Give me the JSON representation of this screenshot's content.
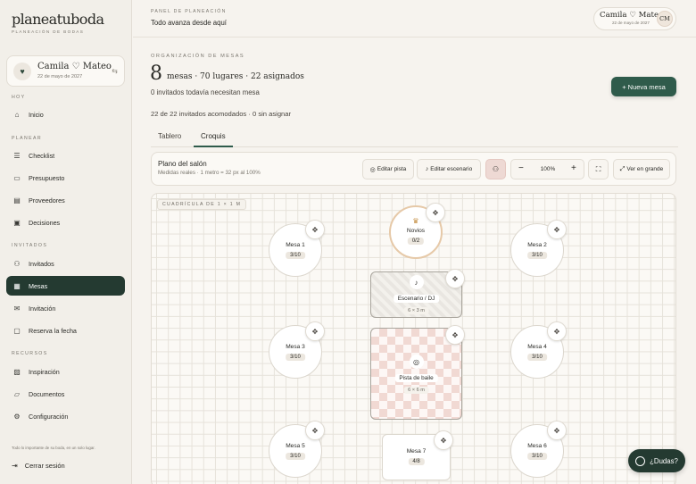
{
  "sidebar": {
    "brand": "planeatuboda",
    "brand_sub": "PLANEACIÓN DE BODAS",
    "couple": {
      "names": "Camila ♡ Mateo",
      "date": "22 de mayo de 2027",
      "heart_icon": "heart-icon",
      "switch_icon": "switch-icon"
    },
    "sections": {
      "hoy": "HOY",
      "planear": "PLANEAR",
      "invitados": "INVITADOS",
      "recursos": "RECURSOS"
    },
    "items": [
      {
        "label": "Inicio",
        "icon": "home-icon"
      },
      {
        "label": "Checklist",
        "icon": "checklist-icon"
      },
      {
        "label": "Presupuesto",
        "icon": "wallet-icon"
      },
      {
        "label": "Proveedores",
        "icon": "store-icon"
      },
      {
        "label": "Decisiones",
        "icon": "decision-icon"
      },
      {
        "label": "Invitados",
        "icon": "users-icon"
      },
      {
        "label": "Mesas",
        "icon": "table-icon"
      },
      {
        "label": "Invitación",
        "icon": "mail-icon"
      },
      {
        "label": "Reserva la fecha",
        "icon": "calendar-icon"
      },
      {
        "label": "Inspiración",
        "icon": "image-icon"
      },
      {
        "label": "Documentos",
        "icon": "folder-icon"
      },
      {
        "label": "Configuración",
        "icon": "gear-icon"
      }
    ],
    "footer": "Todo lo importante de su boda, en un solo lugar.",
    "logout": "Cerrar sesión"
  },
  "topbar": {
    "label": "PANEL DE PLANEACIÓN",
    "title": "Todo avanza desde aquí",
    "user": {
      "names": "Camila ♡ Mateo",
      "date": "22 de mayo de 2027",
      "initials": "CM"
    }
  },
  "main": {
    "label": "ORGANIZACIÓN DE MESAS",
    "count": "8",
    "stats": "mesas · 70 lugares · 22 asignados",
    "pending": "0 invitados todavía necesitan mesa",
    "new_button": "+ Nueva mesa",
    "seated": "22 de 22 invitados acomodados · 0 sin asignar",
    "tabs": [
      {
        "label": "Tablero"
      },
      {
        "label": "Croquis"
      }
    ]
  },
  "toolbar": {
    "title": "Plano del salón",
    "subtitle": "Medidas reales · 1 metro = 32 px al 100%",
    "edit_room": "Editar pista",
    "edit_stage": "Editar escenario",
    "zoom": "100%",
    "fullscreen": "Ver en grande"
  },
  "canvas": {
    "grid_label": "CUADRÍCULA DE 1 × 1 M",
    "tables": [
      {
        "name": "Novios",
        "occ": "0/2"
      },
      {
        "name": "Mesa 1",
        "occ": "3/10"
      },
      {
        "name": "Mesa 2",
        "occ": "3/10"
      },
      {
        "name": "Mesa 3",
        "occ": "3/10"
      },
      {
        "name": "Mesa 4",
        "occ": "3/10"
      },
      {
        "name": "Mesa 5",
        "occ": "3/10"
      },
      {
        "name": "Mesa 6",
        "occ": "3/10"
      },
      {
        "name": "Mesa 7",
        "occ": "4/8"
      }
    ],
    "stage": {
      "name": "Escenario / DJ",
      "size": "6 × 3 m"
    },
    "dance": {
      "name": "Pista de baile",
      "size": "6 × 6 m"
    }
  },
  "help": "¿Dudas?"
}
